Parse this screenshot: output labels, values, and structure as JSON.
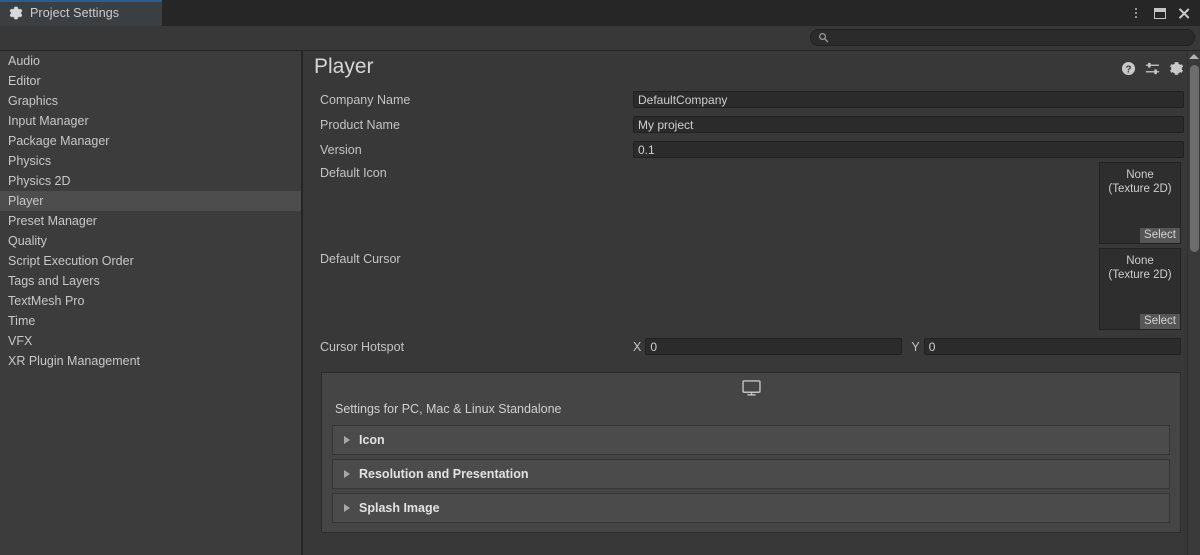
{
  "window": {
    "tab_label": "Project Settings",
    "tab_icon": "gear-icon",
    "menu_icon": "more-vertical-icon",
    "maximize_icon": "maximize-icon",
    "close_icon": "close-icon",
    "accent_color": "#2c5d87",
    "background_color": "#383838"
  },
  "search": {
    "value": "",
    "placeholder": "",
    "icon": "search-icon"
  },
  "sidebar": {
    "items": [
      {
        "label": "Audio",
        "selected": false
      },
      {
        "label": "Editor",
        "selected": false
      },
      {
        "label": "Graphics",
        "selected": false
      },
      {
        "label": "Input Manager",
        "selected": false
      },
      {
        "label": "Package Manager",
        "selected": false
      },
      {
        "label": "Physics",
        "selected": false
      },
      {
        "label": "Physics 2D",
        "selected": false
      },
      {
        "label": "Player",
        "selected": true
      },
      {
        "label": "Preset Manager",
        "selected": false
      },
      {
        "label": "Quality",
        "selected": false
      },
      {
        "label": "Script Execution Order",
        "selected": false
      },
      {
        "label": "Tags and Layers",
        "selected": false
      },
      {
        "label": "TextMesh Pro",
        "selected": false
      },
      {
        "label": "Time",
        "selected": false
      },
      {
        "label": "VFX",
        "selected": false
      },
      {
        "label": "XR Plugin Management",
        "selected": false
      }
    ]
  },
  "panel": {
    "title": "Player",
    "help_icon": "help-icon",
    "preset_icon": "preset-icon",
    "settings_icon": "gear-icon"
  },
  "fields": {
    "company_name": {
      "label": "Company Name",
      "value": "DefaultCompany"
    },
    "product_name": {
      "label": "Product Name",
      "value": "My project"
    },
    "version": {
      "label": "Version",
      "value": "0.1"
    },
    "default_icon": {
      "label": "Default Icon",
      "value": "None\n(Texture 2D)",
      "value_line1": "None",
      "value_line2": "(Texture 2D)",
      "select_label": "Select"
    },
    "default_cursor": {
      "label": "Default Cursor",
      "value_line1": "None",
      "value_line2": "(Texture 2D)",
      "select_label": "Select"
    },
    "cursor_hotspot": {
      "label": "Cursor Hotspot",
      "x_label": "X",
      "x_value": "0",
      "y_label": "Y",
      "y_value": "0"
    }
  },
  "platform": {
    "tab_icon": "desktop-monitor-icon",
    "settings_label": "Settings for PC, Mac & Linux Standalone",
    "sections": [
      {
        "label": "Icon",
        "expanded": false
      },
      {
        "label": "Resolution and Presentation",
        "expanded": false
      },
      {
        "label": "Splash Image",
        "expanded": false
      }
    ]
  },
  "scrollbar": {
    "up_arrow_icon": "chevron-up-icon"
  }
}
